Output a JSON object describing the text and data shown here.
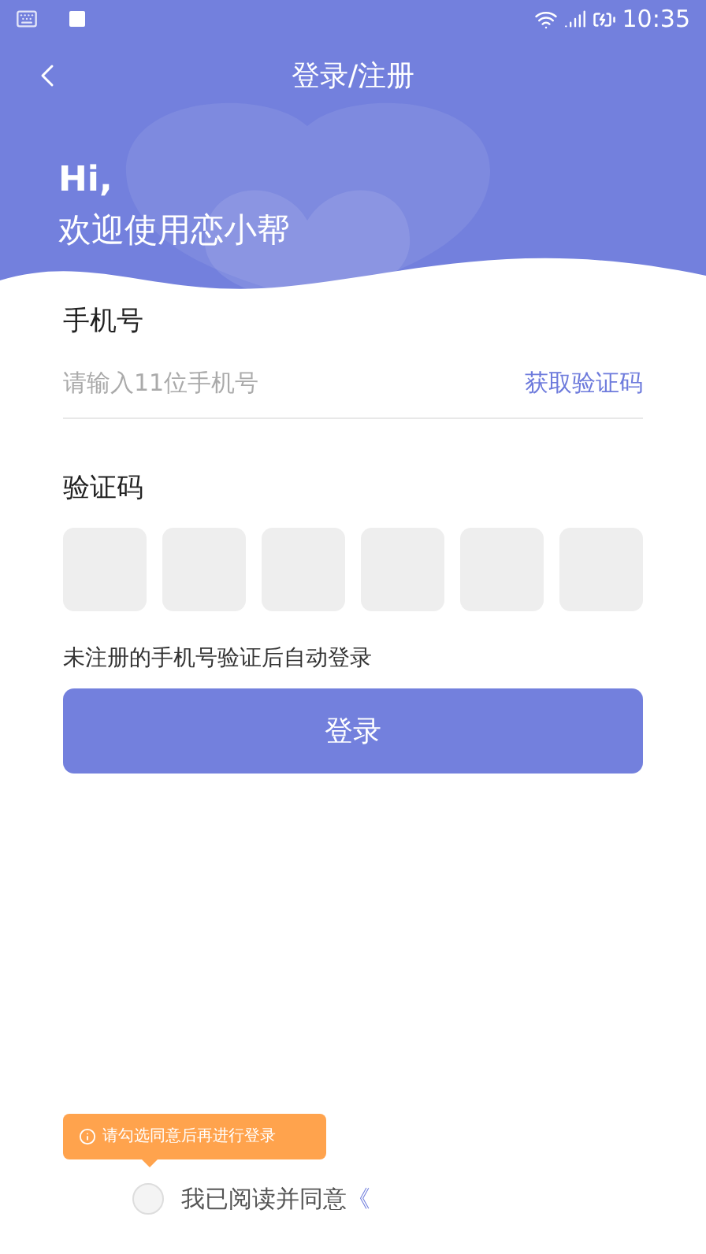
{
  "status_bar": {
    "time": "10:35"
  },
  "header": {
    "title": "登录/注册",
    "greeting": "Hi,",
    "welcome": "欢迎使用恋小帮"
  },
  "phone": {
    "label": "手机号",
    "placeholder": "请输入11位手机号",
    "code_link": "获取验证码"
  },
  "code": {
    "label": "验证码",
    "cells": [
      {
        "filled": false
      },
      {
        "filled": false
      },
      {
        "filled": false
      },
      {
        "filled": false
      },
      {
        "filled": false
      },
      {
        "filled": false
      }
    ]
  },
  "note": "未注册的手机号验证后自动登录",
  "login_button": "登录",
  "tooltip": "请勾选同意后再进行登录",
  "agreement": {
    "checked": false,
    "text": "我已阅读并同意",
    "link": "《"
  }
}
